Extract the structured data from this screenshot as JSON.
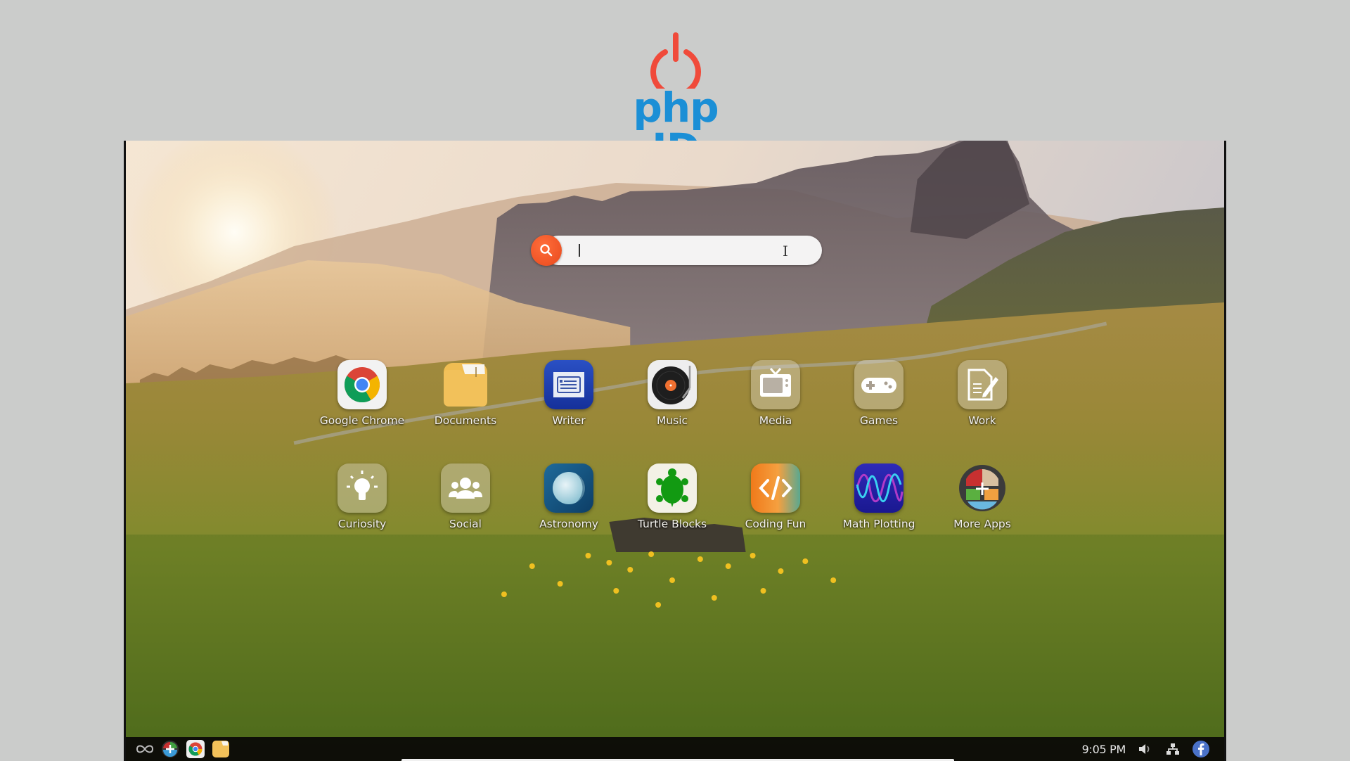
{
  "logo": {
    "text": "php ID",
    "icon": "power-icon",
    "colors": {
      "power": "#f04a3a",
      "text": "#1b8fd6"
    }
  },
  "search": {
    "value": "",
    "icon": "search-icon",
    "accent": "#f05a28"
  },
  "apps": [
    {
      "label": "Google Chrome",
      "icon": "chrome-icon"
    },
    {
      "label": "Documents",
      "icon": "folder-icon"
    },
    {
      "label": "Writer",
      "icon": "writer-icon"
    },
    {
      "label": "Music",
      "icon": "turntable-icon"
    },
    {
      "label": "Media",
      "icon": "tv-icon"
    },
    {
      "label": "Games",
      "icon": "gamepad-icon"
    },
    {
      "label": "Work",
      "icon": "document-edit-icon"
    },
    {
      "label": "Curiosity",
      "icon": "lightbulb-icon"
    },
    {
      "label": "Social",
      "icon": "people-icon"
    },
    {
      "label": "Astronomy",
      "icon": "moon-icon"
    },
    {
      "label": "Turtle Blocks",
      "icon": "turtle-icon"
    },
    {
      "label": "Coding Fun",
      "icon": "code-icon"
    },
    {
      "label": "Math Plotting",
      "icon": "wave-icon"
    },
    {
      "label": "More Apps",
      "icon": "add-apps-icon"
    }
  ],
  "taskbar": {
    "launcher_icon": "infinity-icon",
    "pinned": [
      {
        "name": "More Apps",
        "icon": "add-apps-icon"
      },
      {
        "name": "Google Chrome",
        "icon": "chrome-icon"
      },
      {
        "name": "Documents",
        "icon": "folder-icon"
      }
    ],
    "clock": "9:05 PM",
    "tray": [
      {
        "name": "Volume",
        "icon": "volume-icon"
      },
      {
        "name": "Network",
        "icon": "network-icon"
      },
      {
        "name": "Facebook",
        "icon": "facebook-icon"
      }
    ]
  }
}
